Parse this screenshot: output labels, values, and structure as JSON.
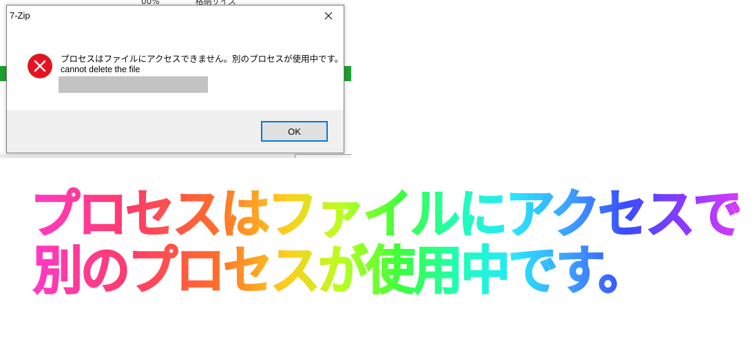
{
  "background_window": {
    "column_headers": [
      "00%",
      "格納サイズ"
    ]
  },
  "dialog": {
    "title": "7-Zip",
    "icon": "error-icon",
    "message_line1": "プロセスはファイルにアクセスできません。別のプロセスが使用中です。",
    "message_line2": "cannot delete the file",
    "ok_label": "OK"
  },
  "banner": {
    "line1": "プロセスはファイルにアクセスできません。",
    "line2": "別のプロセスが使用中です。"
  },
  "colors": {
    "error_red": "#e81123",
    "button_focus": "#0078d7",
    "footer_bg": "#f0f0f0",
    "green_bar": "#1aa12e"
  }
}
